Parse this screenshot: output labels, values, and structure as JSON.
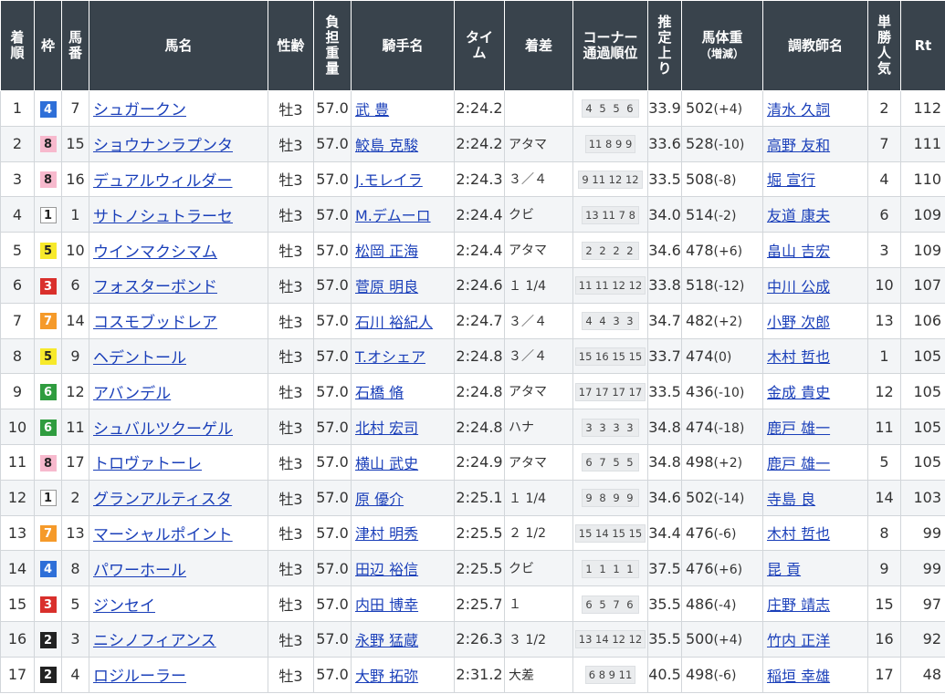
{
  "headers": {
    "rank": [
      "着",
      "順"
    ],
    "waku": "枠",
    "umaban": [
      "馬",
      "番"
    ],
    "horse": "馬名",
    "sexage": "性齢",
    "weight": [
      "負",
      "担",
      "重",
      "量"
    ],
    "jockey": "騎手名",
    "time": [
      "タイ",
      "ム"
    ],
    "margin": "着差",
    "corner": [
      "コーナー",
      "通過順位"
    ],
    "last3f": [
      "推",
      "定",
      "上",
      "り"
    ],
    "body": [
      "馬体重",
      "（増減）"
    ],
    "trainer": "調教師名",
    "pop": [
      "単",
      "勝",
      "人",
      "気"
    ],
    "rt": "Rt"
  },
  "colors": {
    "header_bg": "#39434c",
    "link": "#1a3fb9",
    "waku_1": "#ffffff",
    "waku_2": "#222222",
    "waku_3": "#d9302c",
    "waku_4": "#2e6fd8",
    "waku_5": "#f7e92b",
    "waku_6": "#2f9c3f",
    "waku_7": "#f59a2a",
    "waku_8": "#f7b9cd"
  },
  "rows": [
    {
      "rank": "1",
      "waku": "4",
      "umaban": "7",
      "horse": "シュガークン",
      "sexage": "牡3",
      "weight": "57.0",
      "jockey": "武 豊",
      "time": "2:24.2",
      "margin": "",
      "corner": "4 5 5 6",
      "last3f": "33.9",
      "bw": "502",
      "bwd": "(+4)",
      "trainer": "清水 久詞",
      "pop": "2",
      "rt": "112"
    },
    {
      "rank": "2",
      "waku": "8",
      "umaban": "15",
      "horse": "ショウナンラプンタ",
      "sexage": "牡3",
      "weight": "57.0",
      "jockey": "鮫島 克駿",
      "time": "2:24.2",
      "margin": "アタマ",
      "corner": "11 8 9 9",
      "last3f": "33.6",
      "bw": "528",
      "bwd": "(-10)",
      "trainer": "高野 友和",
      "pop": "7",
      "rt": "111"
    },
    {
      "rank": "3",
      "waku": "8",
      "umaban": "16",
      "horse": "デュアルウィルダー",
      "sexage": "牡3",
      "weight": "57.0",
      "jockey": "J.モレイラ",
      "time": "2:24.3",
      "margin": "３／４",
      "corner": "9 11 12 12",
      "last3f": "33.5",
      "bw": "508",
      "bwd": "(-8)",
      "trainer": "堀 宣行",
      "pop": "4",
      "rt": "110"
    },
    {
      "rank": "4",
      "waku": "1",
      "umaban": "1",
      "horse": "サトノシュトラーセ",
      "sexage": "牡3",
      "weight": "57.0",
      "jockey": "M.デムーロ",
      "time": "2:24.4",
      "margin": "クビ",
      "corner": "13 11 7 8",
      "last3f": "34.0",
      "bw": "514",
      "bwd": "(-2)",
      "trainer": "友道 康夫",
      "pop": "6",
      "rt": "109"
    },
    {
      "rank": "5",
      "waku": "5",
      "umaban": "10",
      "horse": "ウインマクシマム",
      "sexage": "牡3",
      "weight": "57.0",
      "jockey": "松岡 正海",
      "time": "2:24.4",
      "margin": "アタマ",
      "corner": "2 2 2 2",
      "last3f": "34.6",
      "bw": "478",
      "bwd": "(+6)",
      "trainer": "畠山 吉宏",
      "pop": "3",
      "rt": "109"
    },
    {
      "rank": "6",
      "waku": "3",
      "umaban": "6",
      "horse": "フォスターボンド",
      "sexage": "牡3",
      "weight": "57.0",
      "jockey": "菅原 明良",
      "time": "2:24.6",
      "margin": "１ 1/4",
      "corner": "11 11 12 12",
      "last3f": "33.8",
      "bw": "518",
      "bwd": "(-12)",
      "trainer": "中川 公成",
      "pop": "10",
      "rt": "107"
    },
    {
      "rank": "7",
      "waku": "7",
      "umaban": "14",
      "horse": "コスモブッドレア",
      "sexage": "牡3",
      "weight": "57.0",
      "jockey": "石川 裕紀人",
      "time": "2:24.7",
      "margin": "３／４",
      "corner": "4 4 3 3",
      "last3f": "34.7",
      "bw": "482",
      "bwd": "(+2)",
      "trainer": "小野 次郎",
      "pop": "13",
      "rt": "106"
    },
    {
      "rank": "8",
      "waku": "5",
      "umaban": "9",
      "horse": "ヘデントール",
      "sexage": "牡3",
      "weight": "57.0",
      "jockey": "T.オシェア",
      "time": "2:24.8",
      "margin": "３／４",
      "corner": "15 16 15 15",
      "last3f": "33.7",
      "bw": "474",
      "bwd": "(0)",
      "trainer": "木村 哲也",
      "pop": "1",
      "rt": "105"
    },
    {
      "rank": "9",
      "waku": "6",
      "umaban": "12",
      "horse": "アバンデル",
      "sexage": "牡3",
      "weight": "57.0",
      "jockey": "石橋 脩",
      "time": "2:24.8",
      "margin": "アタマ",
      "corner": "17 17 17 17",
      "last3f": "33.5",
      "bw": "436",
      "bwd": "(-10)",
      "trainer": "金成 貴史",
      "pop": "12",
      "rt": "105"
    },
    {
      "rank": "10",
      "waku": "6",
      "umaban": "11",
      "horse": "シュバルツクーゲル",
      "sexage": "牡3",
      "weight": "57.0",
      "jockey": "北村 宏司",
      "time": "2:24.8",
      "margin": "ハナ",
      "corner": "3 3 3 3",
      "last3f": "34.8",
      "bw": "474",
      "bwd": "(-18)",
      "trainer": "鹿戸 雄一",
      "pop": "11",
      "rt": "105"
    },
    {
      "rank": "11",
      "waku": "8",
      "umaban": "17",
      "horse": "トロヴァトーレ",
      "sexage": "牡3",
      "weight": "57.0",
      "jockey": "横山 武史",
      "time": "2:24.9",
      "margin": "アタマ",
      "corner": "6 7 5 5",
      "last3f": "34.8",
      "bw": "498",
      "bwd": "(+2)",
      "trainer": "鹿戸 雄一",
      "pop": "5",
      "rt": "105"
    },
    {
      "rank": "12",
      "waku": "1",
      "umaban": "2",
      "horse": "グランアルティスタ",
      "sexage": "牡3",
      "weight": "57.0",
      "jockey": "原 優介",
      "time": "2:25.1",
      "margin": "１ 1/4",
      "corner": "9 8 9 9",
      "last3f": "34.6",
      "bw": "502",
      "bwd": "(-14)",
      "trainer": "寺島 良",
      "pop": "14",
      "rt": "103"
    },
    {
      "rank": "13",
      "waku": "7",
      "umaban": "13",
      "horse": "マーシャルポイント",
      "sexage": "牡3",
      "weight": "57.0",
      "jockey": "津村 明秀",
      "time": "2:25.5",
      "margin": "２ 1/2",
      "corner": "15 14 15 15",
      "last3f": "34.4",
      "bw": "476",
      "bwd": "(-6)",
      "trainer": "木村 哲也",
      "pop": "8",
      "rt": "99"
    },
    {
      "rank": "14",
      "waku": "4",
      "umaban": "8",
      "horse": "パワーホール",
      "sexage": "牡3",
      "weight": "57.0",
      "jockey": "田辺 裕信",
      "time": "2:25.5",
      "margin": "クビ",
      "corner": "1 1 1 1",
      "last3f": "37.5",
      "bw": "476",
      "bwd": "(+6)",
      "trainer": "昆 貢",
      "pop": "9",
      "rt": "99"
    },
    {
      "rank": "15",
      "waku": "3",
      "umaban": "5",
      "horse": "ジンセイ",
      "sexage": "牡3",
      "weight": "57.0",
      "jockey": "内田 博幸",
      "time": "2:25.7",
      "margin": "１",
      "corner": "6 5 7 6",
      "last3f": "35.5",
      "bw": "486",
      "bwd": "(-4)",
      "trainer": "庄野 靖志",
      "pop": "15",
      "rt": "97"
    },
    {
      "rank": "16",
      "waku": "2",
      "umaban": "3",
      "horse": "ニシノフィアンス",
      "sexage": "牡3",
      "weight": "57.0",
      "jockey": "永野 猛蔵",
      "time": "2:26.3",
      "margin": "３ 1/2",
      "corner": "13 14 12 12",
      "last3f": "35.5",
      "bw": "500",
      "bwd": "(+4)",
      "trainer": "竹内 正洋",
      "pop": "16",
      "rt": "92"
    },
    {
      "rank": "17",
      "waku": "2",
      "umaban": "4",
      "horse": "ロジルーラー",
      "sexage": "牡3",
      "weight": "57.0",
      "jockey": "大野 拓弥",
      "time": "2:31.2",
      "margin": "大差",
      "corner": "6 8 9 11",
      "last3f": "40.5",
      "bw": "498",
      "bwd": "(-6)",
      "trainer": "稲垣 幸雄",
      "pop": "17",
      "rt": "48"
    }
  ]
}
